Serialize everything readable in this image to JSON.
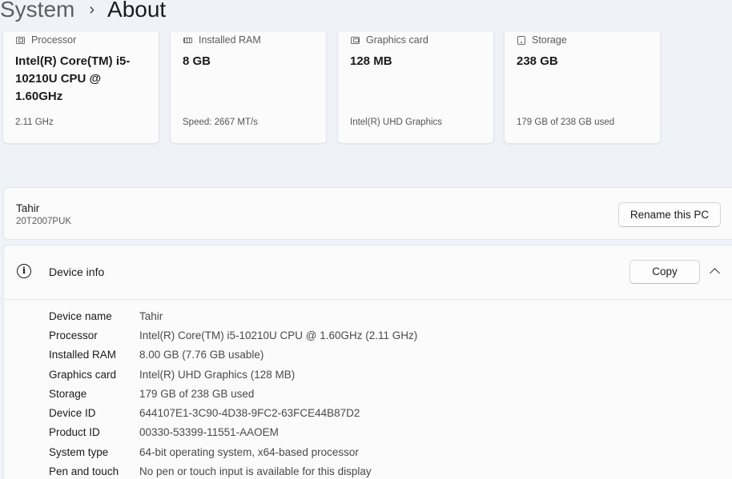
{
  "breadcrumb": {
    "parent": "System",
    "separator": "›",
    "current": "About"
  },
  "spec_cards": [
    {
      "icon": "processor-icon",
      "label": "Processor",
      "value": "Intel(R) Core(TM) i5-10210U CPU @ 1.60GHz",
      "sub": "2.11 GHz"
    },
    {
      "icon": "ram-icon",
      "label": "Installed RAM",
      "value": "8 GB",
      "sub": "Speed: 2667 MT/s"
    },
    {
      "icon": "graphics-card-icon",
      "label": "Graphics card",
      "value": "128 MB",
      "sub": "Intel(R) UHD Graphics"
    },
    {
      "icon": "storage-icon",
      "label": "Storage",
      "value": "238 GB",
      "sub": "179 GB of 238 GB used"
    }
  ],
  "pc": {
    "name": "Tahir",
    "model": "20T2007PUK",
    "rename_label": "Rename this PC"
  },
  "device_info": {
    "title": "Device info",
    "icon": "info-icon",
    "copy_label": "Copy",
    "expand_icon": "chevron-up-icon",
    "rows": [
      {
        "label": "Device name",
        "value": "Tahir"
      },
      {
        "label": "Processor",
        "value": "Intel(R) Core(TM) i5-10210U CPU @ 1.60GHz (2.11 GHz)"
      },
      {
        "label": "Installed RAM",
        "value": "8.00 GB (7.76 GB usable)"
      },
      {
        "label": "Graphics card",
        "value": "Intel(R) UHD Graphics (128 MB)"
      },
      {
        "label": "Storage",
        "value": "179 GB of 238 GB used"
      },
      {
        "label": "Device ID",
        "value": "644107E1-3C90-4D38-9FC2-63FCE44B87D2"
      },
      {
        "label": "Product ID",
        "value": "00330-53399-11551-AAOEM"
      },
      {
        "label": "System type",
        "value": "64-bit operating system, x64-based processor"
      },
      {
        "label": "Pen and touch",
        "value": "No pen or touch input is available for this display"
      }
    ]
  }
}
